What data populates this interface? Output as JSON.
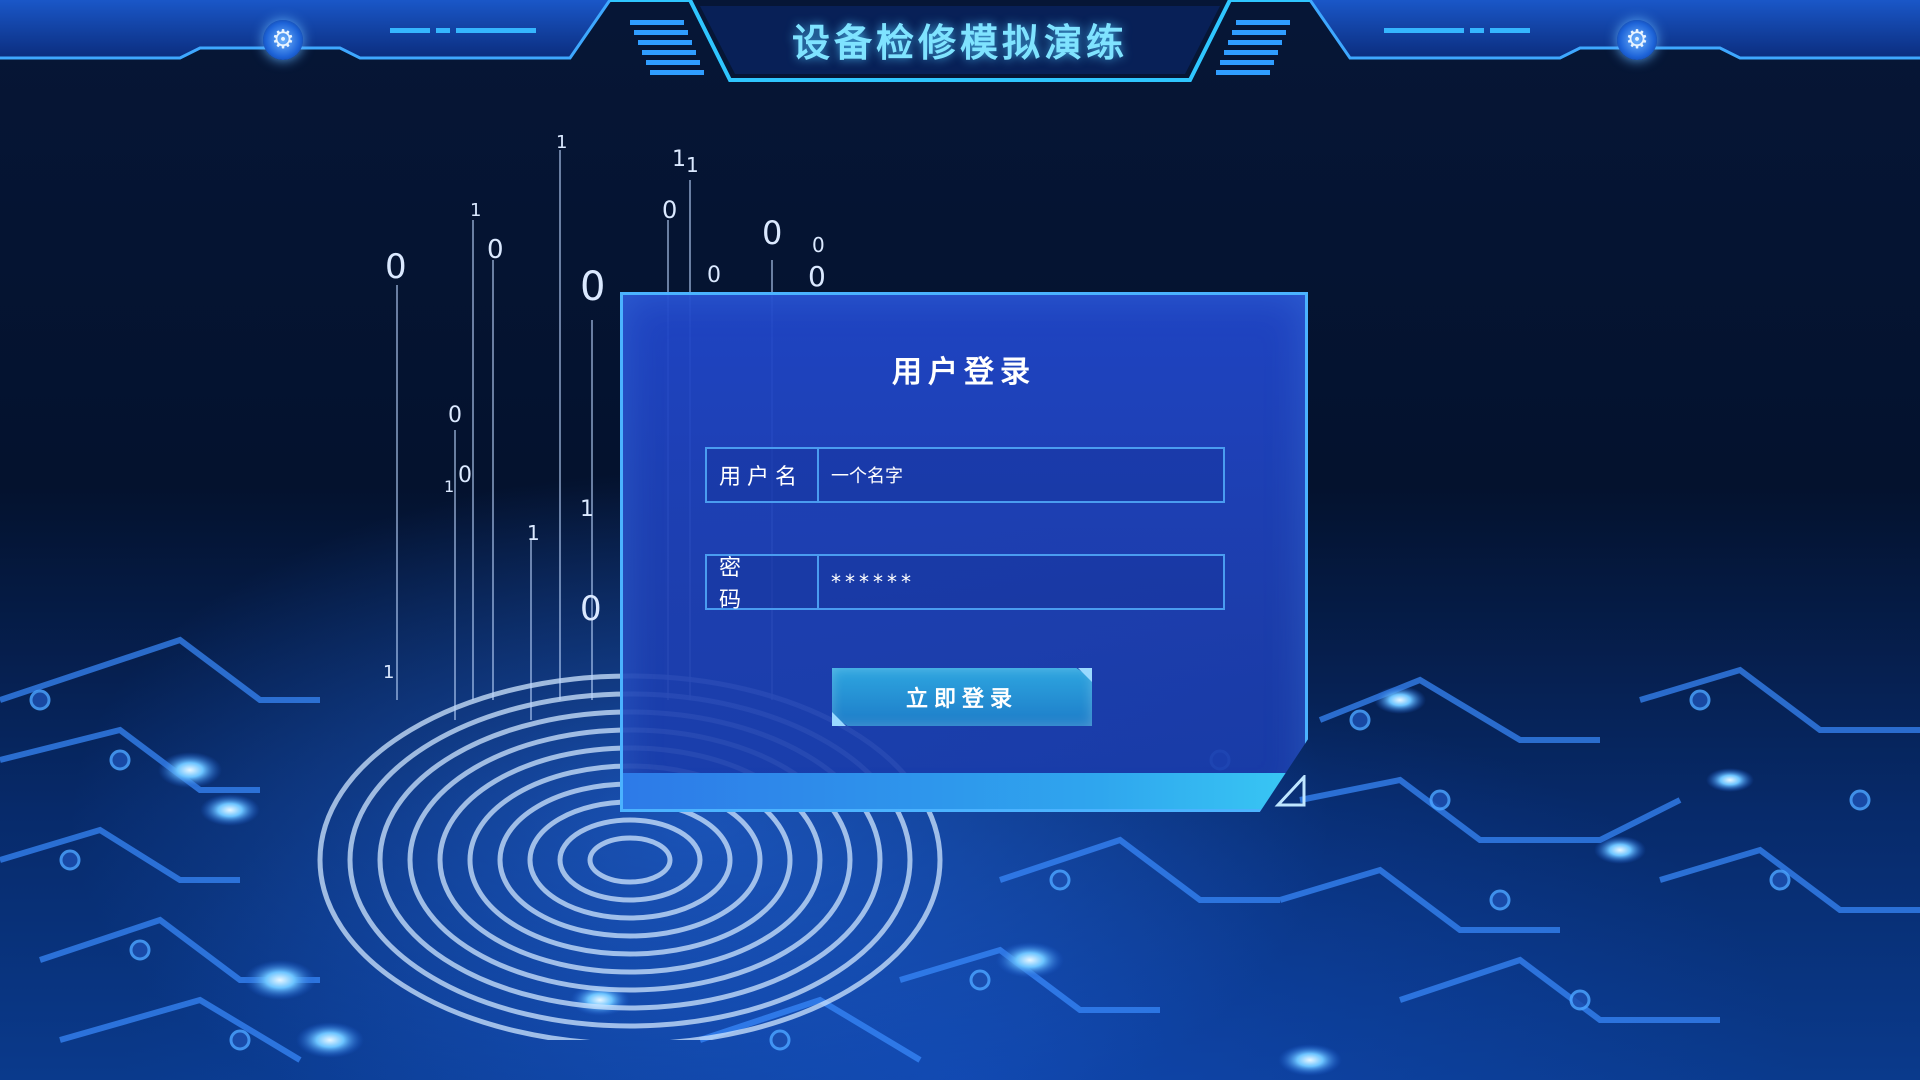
{
  "header": {
    "title": "设备检修模拟演练",
    "gear_icon": "gear-icon"
  },
  "login": {
    "title": "用户登录",
    "username_label": "用户名",
    "username_value": "一个名字",
    "password_label": "密 码",
    "password_value": "******",
    "submit_label": "立即登录"
  },
  "colors": {
    "accent": "#4bb3ff",
    "title": "#7fe3ff",
    "panel": "#2046c8",
    "button": "#2ea6e0"
  }
}
